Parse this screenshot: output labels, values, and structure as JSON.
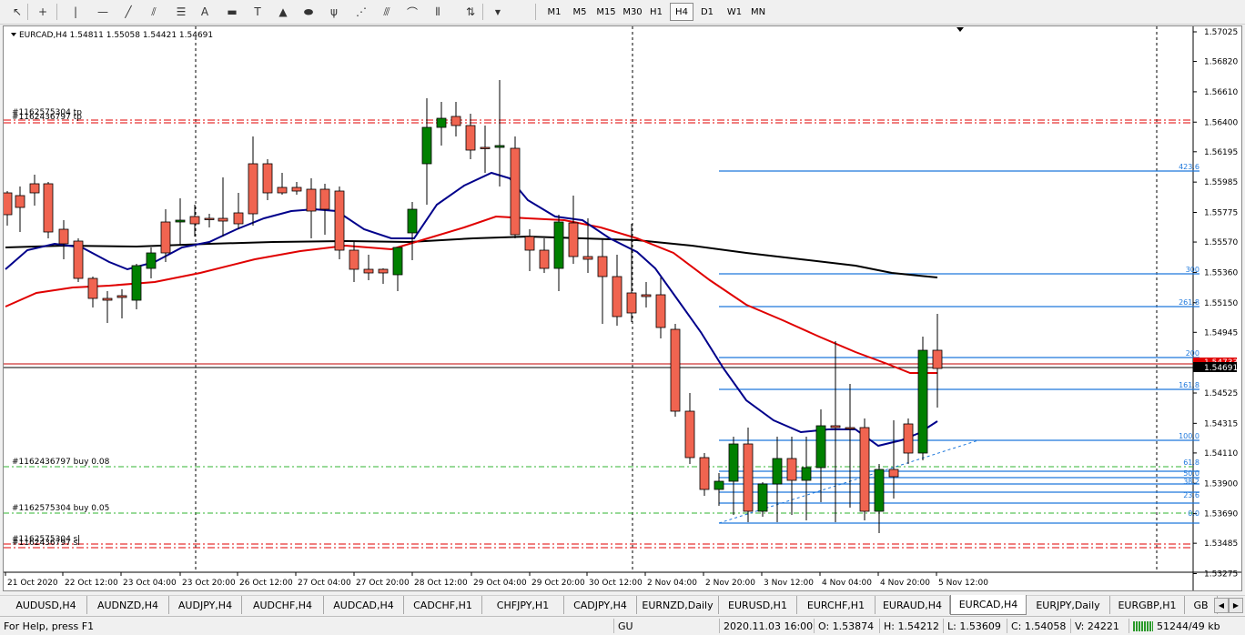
{
  "toolbar": {
    "tools": [
      {
        "name": "cursor-icon",
        "glyph": "↖"
      },
      {
        "name": "crosshair-icon",
        "glyph": "+"
      },
      {
        "name": "vertical-line-icon",
        "glyph": "|"
      },
      {
        "name": "horizontal-line-icon",
        "glyph": "—"
      },
      {
        "name": "trendline-icon",
        "glyph": "╱"
      },
      {
        "name": "equidistant-channel-icon",
        "glyph": "⫽"
      },
      {
        "name": "fibonacci-retracement-icon",
        "glyph": "☰"
      },
      {
        "name": "text-icon",
        "glyph": "A"
      },
      {
        "name": "rectangle-icon",
        "glyph": "▬"
      },
      {
        "name": "text-label-icon",
        "glyph": "T"
      },
      {
        "name": "triangle-icon",
        "glyph": "▲"
      },
      {
        "name": "ellipse-icon",
        "glyph": "⬬"
      },
      {
        "name": "andrews-pitchfork-icon",
        "glyph": "ψ"
      },
      {
        "name": "gann-fan-icon",
        "glyph": "⋰"
      },
      {
        "name": "fibonacci-fan-icon",
        "glyph": "⫻"
      },
      {
        "name": "fibonacci-arcs-icon",
        "glyph": "⌒"
      },
      {
        "name": "fibonacci-timezones-icon",
        "glyph": "⦀"
      },
      {
        "name": "arrows-icon",
        "glyph": "⇅"
      }
    ],
    "timeframes": [
      "M1",
      "M5",
      "M15",
      "M30",
      "H1",
      "H4",
      "D1",
      "W1",
      "MN"
    ],
    "active_timeframe": "H4"
  },
  "chart": {
    "header": "EURCAD,H4  1.54811 1.55058 1.54421 1.54691",
    "price_labels": [
      "1.57025",
      "1.56820",
      "1.56610",
      "1.56400",
      "1.56195",
      "1.55985",
      "1.55775",
      "1.55570",
      "1.55360",
      "1.55150",
      "1.54945",
      "1.54735",
      "1.54525",
      "1.54315",
      "1.54110",
      "1.53900",
      "1.53690",
      "1.53485",
      "1.53275"
    ],
    "bid_label": "1.54691",
    "ask_label": "1.54733",
    "time_labels": [
      "21 Oct 2020",
      "22 Oct 12:00",
      "23 Oct 04:00",
      "23 Oct 20:00",
      "26 Oct 12:00",
      "27 Oct 04:00",
      "27 Oct 20:00",
      "28 Oct 12:00",
      "29 Oct 04:00",
      "29 Oct 20:00",
      "30 Oct 12:00",
      "2 Nov 04:00",
      "2 Nov 20:00",
      "3 Nov 12:00",
      "4 Nov 04:00",
      "4 Nov 20:00",
      "5 Nov 12:00"
    ],
    "fib_levels": [
      "423.6",
      "300",
      "261.8",
      "200",
      "161.8",
      "100.0",
      "61.8",
      "50.0",
      "38.2",
      "23.6",
      "0.0"
    ],
    "order_labels": {
      "tp1": "#1162575304 tp",
      "tp2": "#1162436797 tp",
      "buy1": "#1162436797 buy 0.08",
      "buy2": "#1162575304 buy 0.05",
      "sl1": "#1162575304 sl",
      "sl2": "#1162436797 sl"
    },
    "colors": {
      "bull": "#008000",
      "bear": "#f06450",
      "fib": "#1e78dc",
      "ma_fast": "#00008b",
      "ma_mid": "#e00000",
      "ma_slow": "#000000",
      "tp_sl": "#e00000",
      "buy": "#32b432"
    }
  },
  "tabs": [
    "AUDUSD,H4",
    "AUDNZD,H4",
    "AUDJPY,H4",
    "AUDCHF,H4",
    "AUDCAD,H4",
    "CADCHF,H1",
    "CHFJPY,H1",
    "CADJPY,H4",
    "EURNZD,Daily",
    "EURUSD,H1",
    "EURCHF,H1",
    "EURAUD,H4",
    "EURCAD,H4",
    "EURJPY,Daily",
    "EURGBP,H1",
    "GB"
  ],
  "active_tab": "EURCAD,H4",
  "status": {
    "help": "For Help, press F1",
    "profile": "GU",
    "datetime": "2020.11.03 16:00",
    "open": "O: 1.53874",
    "high": "H: 1.54212",
    "low": "L: 1.53609",
    "close": "C: 1.54058",
    "volume": "V: 24221",
    "traffic": "51244/49 kb"
  }
}
